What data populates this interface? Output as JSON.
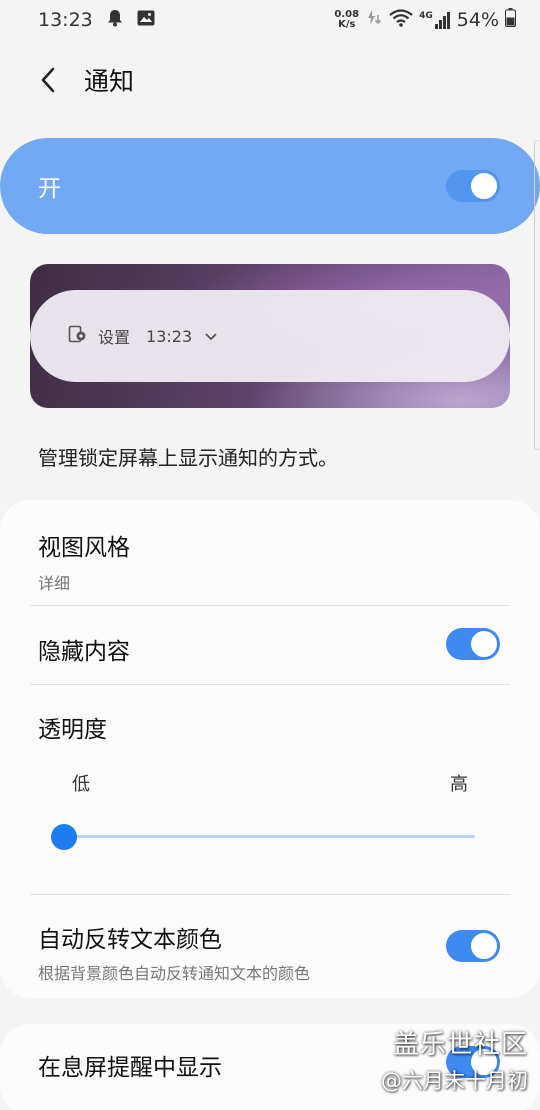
{
  "status_bar": {
    "time": "13:23",
    "netspeed_value": "0.08",
    "netspeed_unit": "K/s",
    "network_type": "4G",
    "battery": "54%"
  },
  "header": {
    "title": "通知"
  },
  "master": {
    "label": "开",
    "enabled": true
  },
  "preview": {
    "app_name": "设置",
    "time": "13:23"
  },
  "description": "管理锁定屏幕上显示通知的方式。",
  "settings": {
    "view_style": {
      "title": "视图风格",
      "value": "详细"
    },
    "hide_content": {
      "title": "隐藏内容",
      "enabled": true
    },
    "transparency": {
      "title": "透明度",
      "low_label": "低",
      "high_label": "高",
      "level": 0
    },
    "auto_invert": {
      "title": "自动反转文本颜色",
      "subtitle": "根据背景颜色自动反转通知文本的颜色",
      "enabled": true
    },
    "aod": {
      "title": "在息屏提醒中显示",
      "enabled": true
    }
  },
  "watermark": {
    "line1": "盖乐世社区",
    "line2": "@六月末十月初"
  },
  "colors": {
    "accent": "#3e8af1",
    "master_bar": "#73a9f2",
    "slider_thumb": "#1d7cf2"
  }
}
